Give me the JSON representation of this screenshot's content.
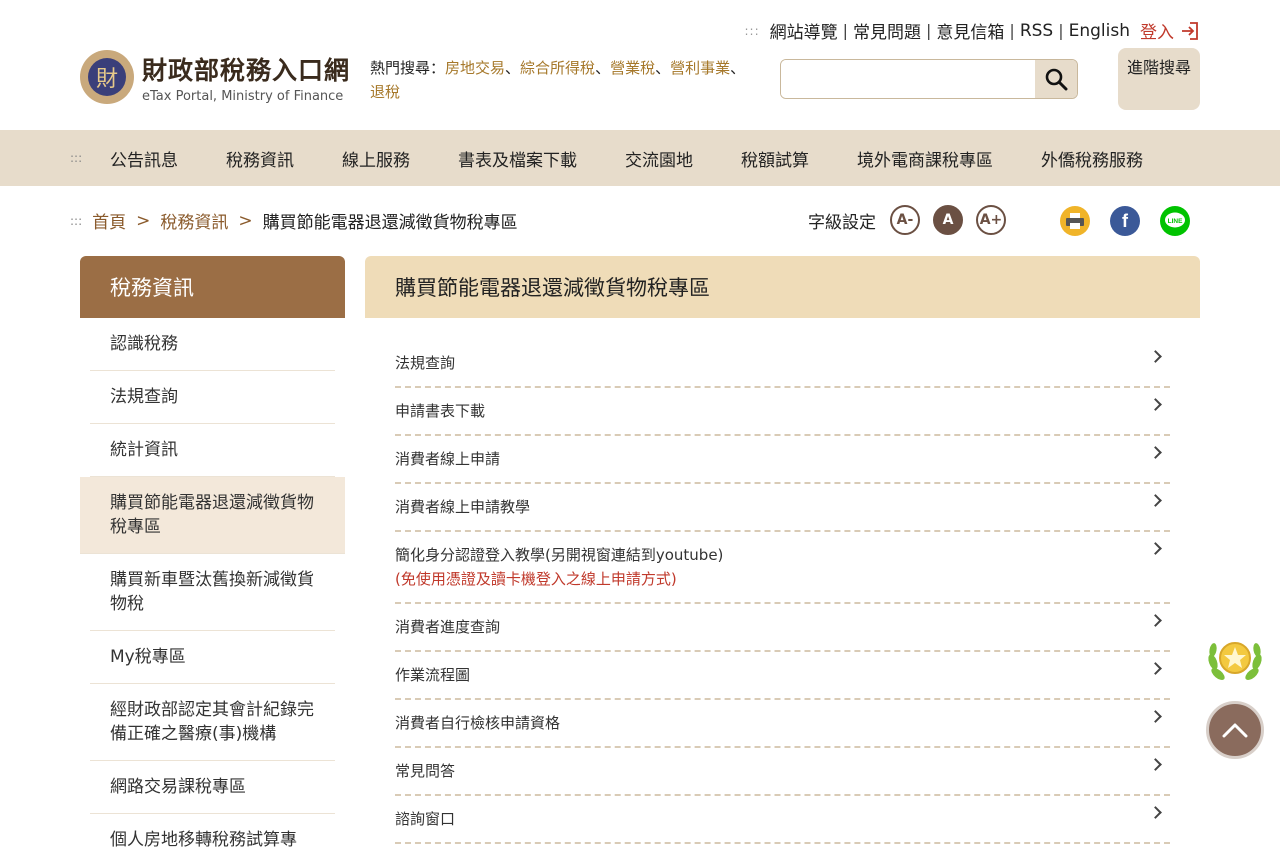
{
  "header": {
    "toplinks": [
      "網站導覽",
      "常見問題",
      "意見信箱",
      "RSS",
      "English"
    ],
    "login_label": "登入",
    "logo_zh": "財政部稅務入口網",
    "logo_en": "eTax Portal, Ministry of Finance",
    "hot_label": "熱門搜尋：",
    "hot_terms": [
      "房地交易",
      "綜合所得稅",
      "營業稅",
      "營利事業",
      "退稅"
    ],
    "search_placeholder": "",
    "advanced_search": "進階搜尋"
  },
  "nav": {
    "items": [
      "公告訊息",
      "稅務資訊",
      "線上服務",
      "書表及檔案下載",
      "交流園地",
      "稅額試算",
      "境外電商課稅專區",
      "外僑稅務服務"
    ]
  },
  "breadcrumb": {
    "items": [
      "首頁",
      "稅務資訊",
      "購買節能電器退還減徵貨物稅專區"
    ]
  },
  "fontsize": {
    "label": "字級設定",
    "small": "A-",
    "medium": "A",
    "large": "A+"
  },
  "sidebar": {
    "title": "稅務資訊",
    "items": [
      "認識稅務",
      "法規查詢",
      "統計資訊",
      "購買節能電器退還減徵貨物稅專區",
      "購買新車暨汰舊換新減徵貨物稅",
      "My稅專區",
      "經財政部認定其會計紀錄完備正確之醫療(事)機構",
      "網路交易課稅專區",
      "個人房地移轉稅務試算專"
    ],
    "active_index": 3
  },
  "main": {
    "title": "購買節能電器退還減徵貨物稅專區",
    "items": [
      {
        "label": "法規查詢",
        "sub": ""
      },
      {
        "label": "申請書表下載",
        "sub": ""
      },
      {
        "label": "消費者線上申請",
        "sub": ""
      },
      {
        "label": "消費者線上申請教學",
        "sub": ""
      },
      {
        "label": "簡化身分認證登入教學(另開視窗連結到youtube)",
        "sub": "(免使用憑證及讀卡機登入之線上申請方式)"
      },
      {
        "label": "消費者進度查詢",
        "sub": ""
      },
      {
        "label": "作業流程圖",
        "sub": ""
      },
      {
        "label": "消費者自行檢核申請資格",
        "sub": ""
      },
      {
        "label": "常見問答",
        "sub": ""
      },
      {
        "label": "諮詢窗口",
        "sub": ""
      }
    ]
  },
  "icons": {
    "search": "search-icon",
    "login": "login-icon",
    "print": "print-icon",
    "facebook": "facebook-icon",
    "line": "line-icon",
    "award": "award-icon",
    "back_to_top": "chevron-up-icon"
  },
  "colors": {
    "nav_bg": "#e7dccb",
    "sidebar_title_bg": "#9b6e45",
    "panel_title_bg": "#efdcb8",
    "accent_link": "#a6782a",
    "alert_red": "#c0392b"
  }
}
